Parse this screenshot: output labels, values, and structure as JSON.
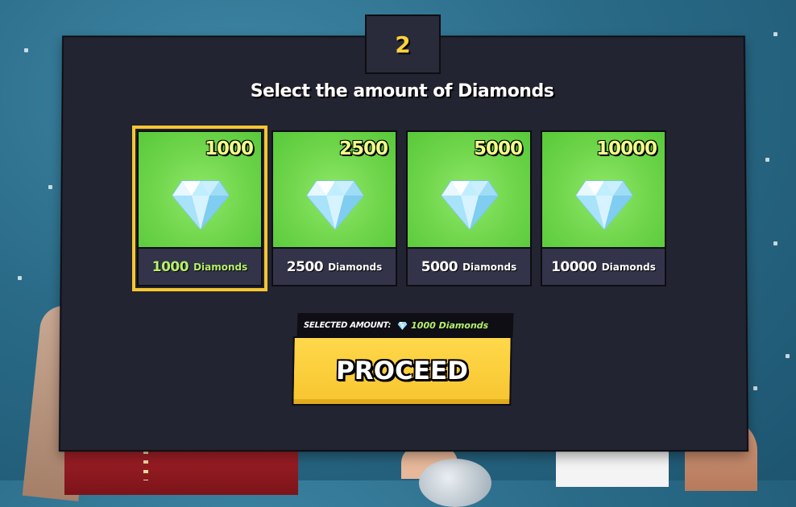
{
  "step": {
    "number": "2"
  },
  "title": "Select the amount of Diamonds",
  "options": [
    {
      "amount": "1000",
      "bottom_number": "1000",
      "bottom_unit": "Diamonds",
      "selected": true
    },
    {
      "amount": "2500",
      "bottom_number": "2500",
      "bottom_unit": "Diamonds",
      "selected": false
    },
    {
      "amount": "5000",
      "bottom_number": "5000",
      "bottom_unit": "Diamonds",
      "selected": false
    },
    {
      "amount": "10000",
      "bottom_number": "10000",
      "bottom_unit": "Diamonds",
      "selected": false
    }
  ],
  "selection": {
    "label": "SELECTED AMOUNT:",
    "value": "1000 Diamonds"
  },
  "proceed_label": "PROCEED",
  "icons": {
    "card": "diamond-icon",
    "selection": "diamond-icon"
  },
  "colors": {
    "panel": "#232431",
    "card_green": "#6fd54a",
    "selected_outline": "#f7c632",
    "accent_green": "#b7f06a",
    "proceed_yellow": "#f7c52f",
    "step_number": "#ffd23c"
  }
}
